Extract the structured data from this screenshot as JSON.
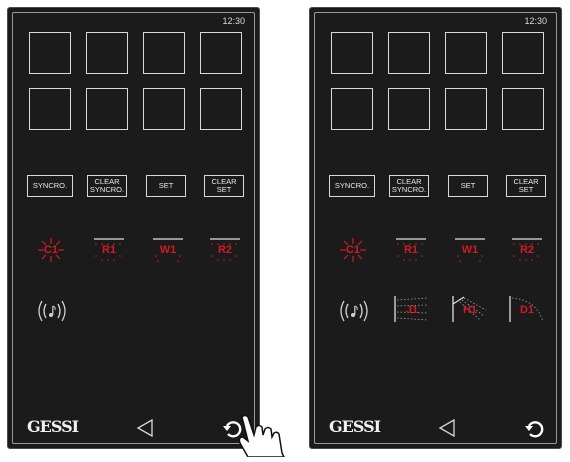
{
  "panels": [
    {
      "clock": "12:30",
      "buttons": {
        "syncro": "SYNCRO.",
        "clear_syncro": "CLEAR\nSYNCRO.",
        "set": "SET",
        "clear_set": "CLEAR\nSET"
      },
      "lamps": {
        "c1": "C1",
        "r1": "R1",
        "w1": "W1",
        "r2": "R2"
      },
      "brand": "GESSI"
    },
    {
      "clock": "12:30",
      "buttons": {
        "syncro": "SYNCRO.",
        "clear_syncro": "CLEAR\nSYNCRO.",
        "set": "SET",
        "clear_set": "CLEAR\nSET"
      },
      "lamps": {
        "c1": "C1",
        "r1": "R1",
        "w1": "W1",
        "r2": "R2"
      },
      "effects": {
        "j1": "J1",
        "h1": "H1",
        "d1": "D1"
      },
      "brand": "GESSI"
    }
  ],
  "icons": {
    "music": "music-note-icon",
    "back": "back-triangle-icon",
    "undo": "undo-arrow-icon",
    "hand": "pointing-hand-icon"
  },
  "colors": {
    "accent_red": "#d11a24",
    "panel_bg": "#1b1b1b",
    "line": "#d8d8d8"
  }
}
